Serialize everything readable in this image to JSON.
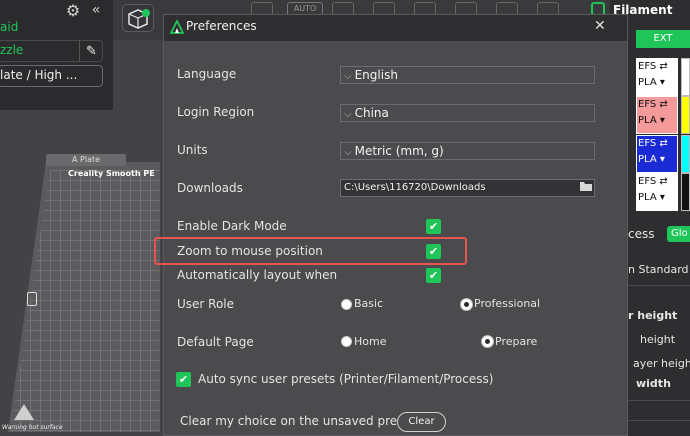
{
  "background": {
    "left_panel": {
      "item_1": "aid",
      "item_2": "zzle",
      "item_3": "late / High ..."
    },
    "toolbar": {
      "auto_label": "AUTO"
    },
    "plate": {
      "tab_label": "A Plate",
      "title": "Creality Smooth PE",
      "warning": "Warning hot surface"
    },
    "right_panel": {
      "title": "Filament",
      "ext_label": "EXT",
      "slots": [
        {
          "line1": "EFS ⇄",
          "line2": "PLA ▾",
          "bg": "#ffffff",
          "swatch": "#ffffff"
        },
        {
          "line1": "EFS ⇄",
          "line2": "PLA ▾",
          "bg": "#f49a9a",
          "swatch": "#ffff00"
        },
        {
          "line1": "EFS ⇄",
          "line2": "PLA ▾",
          "bg": "#1a2bd6",
          "swatch": "#00ffff"
        },
        {
          "line1": "EFS ⇄",
          "line2": "PLA ▾",
          "bg": "#ffffff",
          "swatch": "#111111"
        }
      ],
      "process_label": "cess",
      "glo_label": "Glo",
      "standard_label": "n Standard",
      "height_label": "r height",
      "height2_label": "height",
      "layer_height_label": "ayer heigh",
      "width_label": "width"
    }
  },
  "dialog": {
    "title": "Preferences",
    "close_glyph": "✕",
    "language": {
      "label": "Language",
      "value": "English"
    },
    "login_region": {
      "label": "Login Region",
      "value": "China"
    },
    "units": {
      "label": "Units",
      "value": "Metric (mm, g)"
    },
    "downloads": {
      "label": "Downloads",
      "value": "C:\\Users\\116720\\Downloads"
    },
    "dark_mode": {
      "label": "Enable Dark Mode",
      "checked": true
    },
    "zoom_mouse": {
      "label": "Zoom to mouse position",
      "checked": true
    },
    "auto_layout": {
      "label": "Automatically layout when",
      "checked": true
    },
    "user_role": {
      "label": "User Role",
      "options": [
        "Basic",
        "Professional"
      ],
      "selected": "Professional"
    },
    "default_page": {
      "label": "Default Page",
      "options": [
        "Home",
        "Prepare"
      ],
      "selected": "Prepare"
    },
    "auto_sync": {
      "label": "Auto sync user presets (Printer/Filament/Process)",
      "checked": true
    },
    "clear_choice": {
      "label": "Clear my choice on the unsaved presets.",
      "button": "Clear"
    },
    "check_glyph": "✔",
    "chevron_glyph": "⌵"
  },
  "colors": {
    "accent_green": "#20c55a",
    "highlight_red": "#e5544d",
    "dialog_bg": "#4b4b4e",
    "header_bg": "#2f2f32"
  }
}
